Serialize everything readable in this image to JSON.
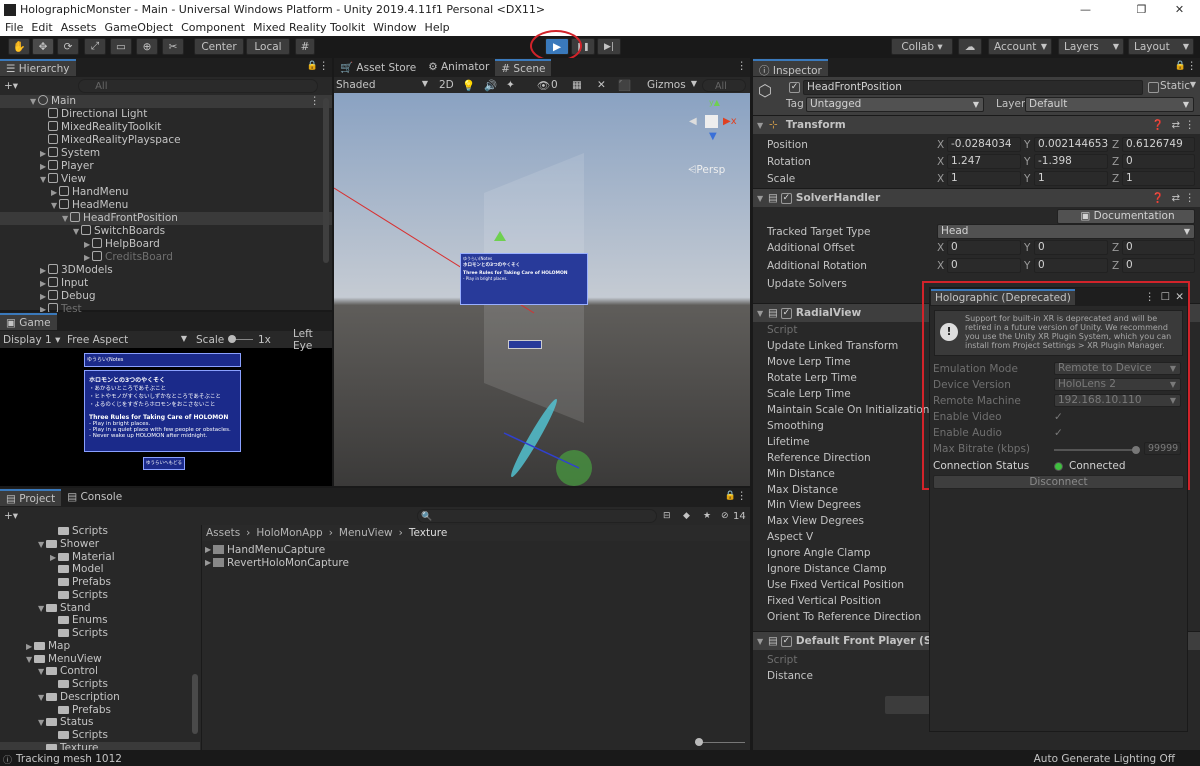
{
  "window": {
    "title": "HolographicMonster - Main - Universal Windows Platform - Unity 2019.4.11f1 Personal <DX11>",
    "min": "—",
    "max": "❐",
    "close": "✕"
  },
  "menu": [
    "File",
    "Edit",
    "Assets",
    "GameObject",
    "Component",
    "Mixed Reality Toolkit",
    "Window",
    "Help"
  ],
  "toolbar": {
    "center": "Center",
    "local": "Local",
    "collab": "Collab ▾",
    "account": "Account",
    "layers": "Layers",
    "layout": "Layout",
    "play": "▶",
    "pause": "❚❚",
    "step": "▶|"
  },
  "hierarchy": {
    "tab": "Hierarchy",
    "search_placeholder": "All",
    "scene": "Main",
    "items": [
      {
        "label": "Directional Light",
        "depth": 1
      },
      {
        "label": "MixedRealityToolkit",
        "depth": 1
      },
      {
        "label": "MixedRealityPlayspace",
        "depth": 1
      },
      {
        "label": "System",
        "depth": 1
      },
      {
        "label": "Player",
        "depth": 1
      },
      {
        "label": "View",
        "depth": 1
      },
      {
        "label": "HandMenu",
        "depth": 2
      },
      {
        "label": "HeadMenu",
        "depth": 2
      },
      {
        "label": "HeadFrontPosition",
        "depth": 3
      },
      {
        "label": "SwitchBoards",
        "depth": 4
      },
      {
        "label": "HelpBoard",
        "depth": 5
      },
      {
        "label": "CreditsBoard",
        "depth": 5
      },
      {
        "label": "3DModels",
        "depth": 1
      },
      {
        "label": "Input",
        "depth": 1
      },
      {
        "label": "Debug",
        "depth": 1
      },
      {
        "label": "Test",
        "depth": 1
      }
    ]
  },
  "game": {
    "tab": "Game",
    "display": "Display 1",
    "aspect": "Free Aspect",
    "scale_label": "Scale",
    "scale_value": "1x",
    "left_eye": "Left Eye",
    "board": {
      "header": "ゆうらい(Notes",
      "title_jp": "ホロモンとの3つのやくそく",
      "jp_lines": [
        "・あかるいところであそぶこと",
        "・ヒトやモノがすくないしずかなところであそぶこと",
        "・よるのくじをすぎたらホロモンをおこさないこと"
      ],
      "title_en": "Three Rules for Taking Care of HOLOMON",
      "en_lines": [
        "- Play in bright places.",
        "- Play in a quiet place with few people or obstacles.",
        "- Never wake up HOLOMON after midnight."
      ],
      "button": "ゆうらいへもどる"
    }
  },
  "scene": {
    "tabs": [
      "Asset Store",
      "Animator",
      "Scene"
    ],
    "shading": "Shaded",
    "mode2d": "2D",
    "fx_count": "0",
    "gizmos": "Gizmos",
    "search_placeholder": "All",
    "persp": "Persp"
  },
  "project": {
    "tabs": [
      "Project",
      "Console"
    ],
    "hidden_count": "14",
    "folders": [
      {
        "label": "Scripts",
        "depth": 3,
        "arrow": ""
      },
      {
        "label": "Shower",
        "depth": 2,
        "arrow": "▼"
      },
      {
        "label": "Material",
        "depth": 3,
        "arrow": "▶"
      },
      {
        "label": "Model",
        "depth": 3,
        "arrow": ""
      },
      {
        "label": "Prefabs",
        "depth": 3,
        "arrow": ""
      },
      {
        "label": "Scripts",
        "depth": 3,
        "arrow": ""
      },
      {
        "label": "Stand",
        "depth": 2,
        "arrow": "▼"
      },
      {
        "label": "Enums",
        "depth": 3,
        "arrow": ""
      },
      {
        "label": "Scripts",
        "depth": 3,
        "arrow": ""
      },
      {
        "label": "Map",
        "depth": 1,
        "arrow": "▶"
      },
      {
        "label": "MenuView",
        "depth": 1,
        "arrow": "▼"
      },
      {
        "label": "Control",
        "depth": 2,
        "arrow": "▼"
      },
      {
        "label": "Scripts",
        "depth": 3,
        "arrow": ""
      },
      {
        "label": "Description",
        "depth": 2,
        "arrow": "▼"
      },
      {
        "label": "Prefabs",
        "depth": 3,
        "arrow": ""
      },
      {
        "label": "Status",
        "depth": 2,
        "arrow": "▼"
      },
      {
        "label": "Scripts",
        "depth": 3,
        "arrow": ""
      },
      {
        "label": "Texture",
        "depth": 2,
        "arrow": ""
      }
    ],
    "breadcrumb": [
      "Assets",
      "HoloMonApp",
      "MenuView",
      "Texture"
    ],
    "assets": [
      "HandMenuCapture",
      "RevertHoloMonCapture"
    ]
  },
  "status": {
    "left": "Tracking mesh 1012",
    "right": "Auto Generate Lighting Off"
  },
  "inspector": {
    "tab": "Inspector",
    "object_name": "HeadFrontPosition",
    "static": "Static",
    "tag_label": "Tag",
    "tag_value": "Untagged",
    "layer_label": "Layer",
    "layer_value": "Default",
    "transform": {
      "title": "Transform",
      "rows": [
        {
          "label": "Position",
          "x": "-0.0284034",
          "y": "0.002144653",
          "z": "0.6126749"
        },
        {
          "label": "Rotation",
          "x": "1.247",
          "y": "-1.398",
          "z": "0"
        },
        {
          "label": "Scale",
          "x": "1",
          "y": "1",
          "z": "1"
        }
      ]
    },
    "solver": {
      "title": "SolverHandler",
      "doc": "Documentation",
      "tracked_label": "Tracked Target Type",
      "tracked_value": "Head",
      "offset_label": "Additional Offset",
      "rotation_label": "Additional Rotation",
      "update_label": "Update Solvers",
      "zero": "0"
    },
    "radial": {
      "title": "RadialView",
      "props": [
        "Script",
        "Update Linked Transform",
        "Move Lerp Time",
        "Rotate Lerp Time",
        "Scale Lerp Time",
        "Maintain Scale On Initialization",
        "Smoothing",
        "Lifetime",
        "Reference Direction",
        "Min Distance",
        "Max Distance",
        "Min View Degrees",
        "Max View Degrees",
        "Aspect V",
        "Ignore Angle Clamp",
        "Ignore Distance Clamp",
        "Use Fixed Vertical Position",
        "Fixed Vertical Position",
        "Orient To Reference Direction"
      ]
    },
    "front": {
      "title": "Default Front Player (Scrip",
      "props": [
        "Script",
        "Distance"
      ]
    }
  },
  "holographic": {
    "title": "Holographic (Deprecated)",
    "warning": "Support for built-in XR is deprecated and will be retired in a future version of Unity. We recommend you use the Unity XR Plugin System, which you can install from Project Settings > XR Plugin Manager.",
    "rows": [
      {
        "label": "Emulation Mode",
        "value": "Remote to Device",
        "kind": "dropdown"
      },
      {
        "label": "Device Version",
        "value": "HoloLens 2",
        "kind": "dropdown"
      },
      {
        "label": "Remote Machine",
        "value": "192.168.10.110",
        "kind": "dropdown"
      },
      {
        "label": "Enable Video",
        "value": "✓",
        "kind": "check"
      },
      {
        "label": "Enable Audio",
        "value": "✓",
        "kind": "check"
      },
      {
        "label": "Max Bitrate (kbps)",
        "value": "99999",
        "kind": "slider"
      }
    ],
    "status_label": "Connection Status",
    "status_value": "Connected",
    "disconnect": "Disconnect",
    "status_color": "#3fbf3f"
  },
  "colors": {
    "accent": "#3a79bb",
    "highlight": "#d2232a",
    "board": "#1b2a8a"
  }
}
